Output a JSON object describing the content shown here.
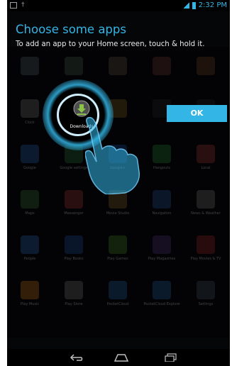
{
  "status_bar": {
    "time": "2:32 PM"
  },
  "header": {
    "title": "Choose some apps",
    "subtitle": "To add an app to your Home screen, touch & hold it."
  },
  "ok_label": "OK",
  "highlight": {
    "label": "Downloads",
    "icon": "download-icon"
  },
  "colors": {
    "accent": "#33b5e5",
    "background": "#050608"
  },
  "apps": [
    {
      "label": "",
      "icon": "app-icon",
      "color": "#5e6b73"
    },
    {
      "label": "",
      "icon": "app-icon",
      "color": "#4e6e55"
    },
    {
      "label": "",
      "icon": "app-icon",
      "color": "#6a5a4a"
    },
    {
      "label": "",
      "icon": "app-icon",
      "color": "#7a3b3b"
    },
    {
      "label": "",
      "icon": "app-icon",
      "color": "#7a4b2b"
    },
    {
      "label": "Clock",
      "icon": "clock-icon",
      "color": "#7b7b7b"
    },
    {
      "label": "",
      "icon": "app-icon",
      "color": "#2c2c2c"
    },
    {
      "label": "",
      "icon": "app-icon",
      "color": "#8a6a24"
    },
    {
      "label": "",
      "icon": "app-icon",
      "color": "#2a2a2a"
    },
    {
      "label": "",
      "icon": "app-icon",
      "color": "#2a2a2a"
    },
    {
      "label": "Google",
      "icon": "google-search-icon",
      "color": "#2c6ac4"
    },
    {
      "label": "Google settings",
      "icon": "google-settings-icon",
      "color": "#2f7f3f"
    },
    {
      "label": "Google+",
      "icon": "google-plus-icon",
      "color": "#1d58b5"
    },
    {
      "label": "Hangouts",
      "icon": "hangouts-icon",
      "color": "#2a8f3a"
    },
    {
      "label": "Local",
      "icon": "local-icon",
      "color": "#b33a3a"
    },
    {
      "label": "Maps",
      "icon": "maps-icon",
      "color": "#3f7a3f"
    },
    {
      "label": "Messenger",
      "icon": "messenger-icon",
      "color": "#b33a3a"
    },
    {
      "label": "Movie Studio",
      "icon": "movie-studio-icon",
      "color": "#8b6b2a"
    },
    {
      "label": "Navigation",
      "icon": "navigation-icon",
      "color": "#2b5aa8"
    },
    {
      "label": "News & Weather",
      "icon": "news-weather-icon",
      "color": "#7a7a7a"
    },
    {
      "label": "People",
      "icon": "people-icon",
      "color": "#2f6fc8"
    },
    {
      "label": "Play Books",
      "icon": "play-books-icon",
      "color": "#1f5aa8"
    },
    {
      "label": "Play Games",
      "icon": "play-games-icon",
      "color": "#4a8f2a"
    },
    {
      "label": "Play Magazines",
      "icon": "play-magazines-icon",
      "color": "#5a3a8a"
    },
    {
      "label": "Play Movies & TV",
      "icon": "play-movies-icon",
      "color": "#a32a2a"
    },
    {
      "label": "Play Music",
      "icon": "play-music-icon",
      "color": "#d97a1a"
    },
    {
      "label": "Play Store",
      "icon": "play-store-icon",
      "color": "#7a7a7a"
    },
    {
      "label": "PocketCloud",
      "icon": "pocketcloud-icon",
      "color": "#2b6ab0"
    },
    {
      "label": "PocketCloud Explore",
      "icon": "pocketcloud-explore-icon",
      "color": "#2b6ab0"
    },
    {
      "label": "Settings",
      "icon": "settings-icon",
      "color": "#4a5a6a"
    }
  ]
}
